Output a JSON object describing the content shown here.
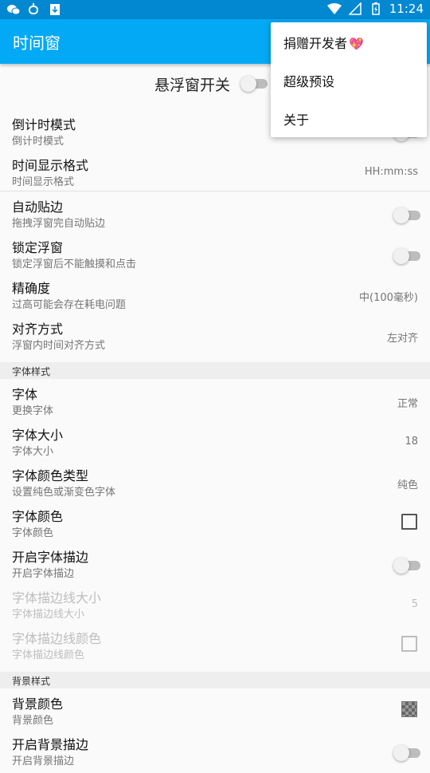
{
  "statusbar": {
    "time": "11:24",
    "icons_left": [
      "wechat-icon",
      "bug-icon",
      "download-icon"
    ],
    "icons_right": [
      "wifi-icon",
      "signal-icon",
      "battery-icon"
    ]
  },
  "appbar": {
    "title": "时间窗"
  },
  "header_toggle": {
    "label": "悬浮窗开关",
    "on": false
  },
  "menu": {
    "items": [
      {
        "label": "捐赠开发者",
        "emoji": "💖"
      },
      {
        "label": "超级预设"
      },
      {
        "label": "关于"
      }
    ]
  },
  "rows": [
    {
      "title": "倒计时模式",
      "sub": "倒计时模式"
    },
    {
      "title": "时间显示格式",
      "sub": "时间显示格式",
      "value": "HH:mm:ss"
    },
    {
      "title": "自动贴边",
      "sub": "拖拽浮窗完自动贴边"
    },
    {
      "title": "锁定浮窗",
      "sub": "锁定浮窗后不能触摸和点击"
    },
    {
      "title": "精确度",
      "sub": "过高可能会存在耗电问题",
      "value": "中(100毫秒)"
    },
    {
      "title": "对齐方式",
      "sub": "浮窗内时间对齐方式",
      "value": "左对齐"
    }
  ],
  "sections": {
    "font": "字体样式",
    "background": "背景样式"
  },
  "font_rows": [
    {
      "title": "字体",
      "sub": "更换字体",
      "value": "正常"
    },
    {
      "title": "字体大小",
      "sub": "字体大小",
      "value": "18"
    },
    {
      "title": "字体颜色类型",
      "sub": "设置纯色或渐变色字体",
      "value": "纯色"
    },
    {
      "title": "字体颜色",
      "sub": "字体颜色"
    },
    {
      "title": "开启字体描边",
      "sub": "开启字体描边"
    },
    {
      "title": "字体描边线大小",
      "sub": "字体描边线大小",
      "value": "5"
    },
    {
      "title": "字体描边线颜色",
      "sub": "字体描边线颜色"
    }
  ],
  "bg_rows": [
    {
      "title": "背景颜色",
      "sub": "背景颜色"
    },
    {
      "title": "开启背景描边",
      "sub": "开启背景描边"
    }
  ],
  "colors": {
    "primary": "#03a9f4",
    "primary_dark": "#0288d1"
  }
}
